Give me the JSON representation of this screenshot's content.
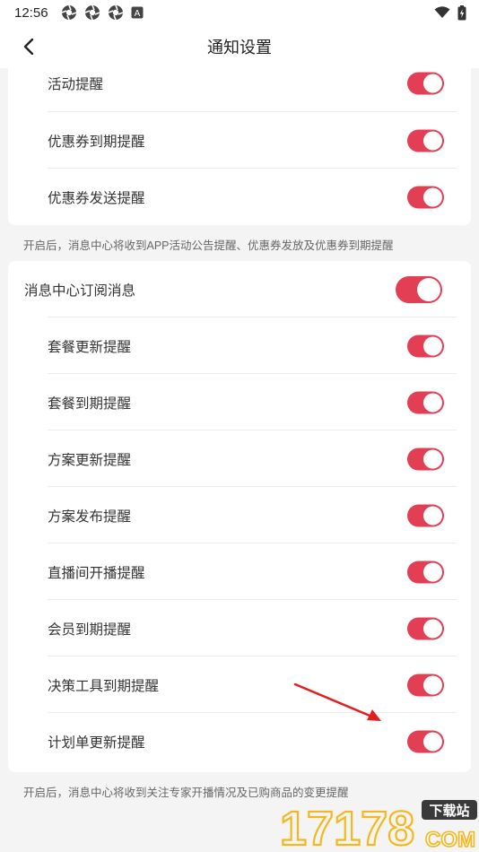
{
  "status_bar": {
    "time": "12:56",
    "icons": [
      "aperture-icon",
      "aperture-icon",
      "aperture-icon",
      "a-badge-icon"
    ],
    "a_badge_text": "A",
    "right_icons": [
      "wifi-icon",
      "battery-charging-icon"
    ]
  },
  "nav": {
    "back_icon": "chevron-left-icon",
    "title": "通知设置"
  },
  "section1": {
    "items": [
      {
        "label": "活动提醒",
        "on": true
      },
      {
        "label": "优惠券到期提醒",
        "on": true
      },
      {
        "label": "优惠券发送提醒",
        "on": true
      }
    ],
    "note": "开启后，消息中心将收到APP活动公告提醒、优惠券发放及优惠券到期提醒"
  },
  "section2": {
    "master": {
      "label": "消息中心订阅消息",
      "on": true
    },
    "items": [
      {
        "label": "套餐更新提醒",
        "on": true
      },
      {
        "label": "套餐到期提醒",
        "on": true
      },
      {
        "label": "方案更新提醒",
        "on": true
      },
      {
        "label": "方案发布提醒",
        "on": true
      },
      {
        "label": "直播间开播提醒",
        "on": true
      },
      {
        "label": "会员到期提醒",
        "on": true
      },
      {
        "label": "决策工具到期提醒",
        "on": true
      },
      {
        "label": "计划单更新提醒",
        "on": true
      }
    ],
    "note": "开启后，消息中心将收到关注专家开播情况及已购商品的变更提醒"
  },
  "watermark": {
    "number": "17178",
    "tag": "下载站",
    "domain": "COM"
  },
  "colors": {
    "toggle_on": "#e23f55",
    "annotation_arrow": "#e02020",
    "background": "#f4f4f4"
  }
}
